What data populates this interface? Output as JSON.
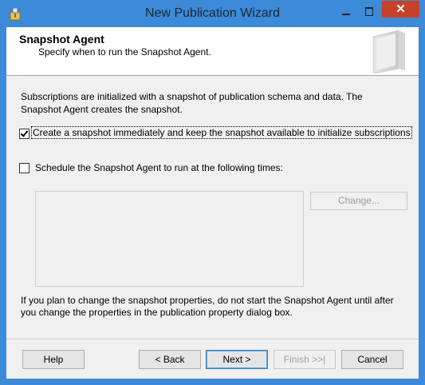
{
  "window": {
    "title": "New Publication Wizard",
    "close_glyph": "✕"
  },
  "header": {
    "title": "Snapshot Agent",
    "subtitle": "Specify when to run the Snapshot Agent."
  },
  "intro_text": "Subscriptions are initialized with a snapshot of publication schema and data. The Snapshot Agent creates the snapshot.",
  "options": {
    "create_snapshot": {
      "label": "Create a snapshot immediately and keep the snapshot available to initialize subscriptions",
      "checked": true
    },
    "schedule": {
      "label": "Schedule the Snapshot Agent to run at the following times:",
      "checked": false
    }
  },
  "change_button": "Change...",
  "note_text": "If you plan to change the snapshot properties, do not start the Snapshot Agent until after you change the properties in the publication property dialog box.",
  "buttons": {
    "help": "Help",
    "back": "< Back",
    "next": "Next >",
    "finish": "Finish >>|",
    "cancel": "Cancel"
  }
}
